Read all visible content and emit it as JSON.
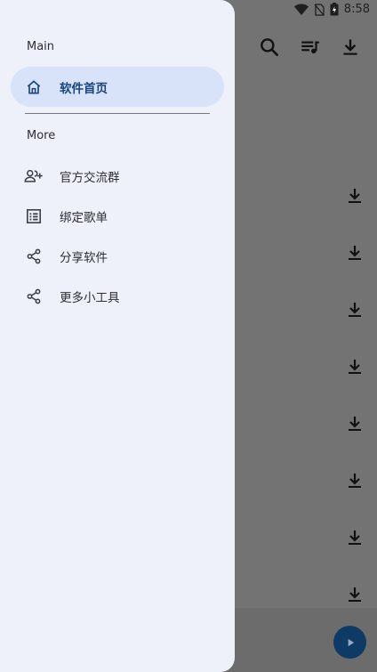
{
  "status_bar": {
    "time": "8:58"
  },
  "drawer": {
    "sections": [
      {
        "title": "Main"
      },
      {
        "title": "More"
      }
    ],
    "main_items": [
      {
        "label": "软件首页",
        "icon": "home-icon",
        "active": true
      }
    ],
    "more_items": [
      {
        "label": "官方交流群",
        "icon": "group-add-icon"
      },
      {
        "label": "绑定歌单",
        "icon": "list-icon"
      },
      {
        "label": "分享软件",
        "icon": "share-icon"
      },
      {
        "label": "更多小工具",
        "icon": "share-icon"
      }
    ]
  },
  "app_toolbar": {
    "icons": [
      "search-icon",
      "playlist-icon",
      "download-icon"
    ]
  },
  "colors": {
    "drawer_bg": "#eef1fa",
    "active_bg": "#d8e2f8",
    "active_text": "#17457c",
    "scrim": "#737373",
    "fab": "#0e3a66"
  }
}
